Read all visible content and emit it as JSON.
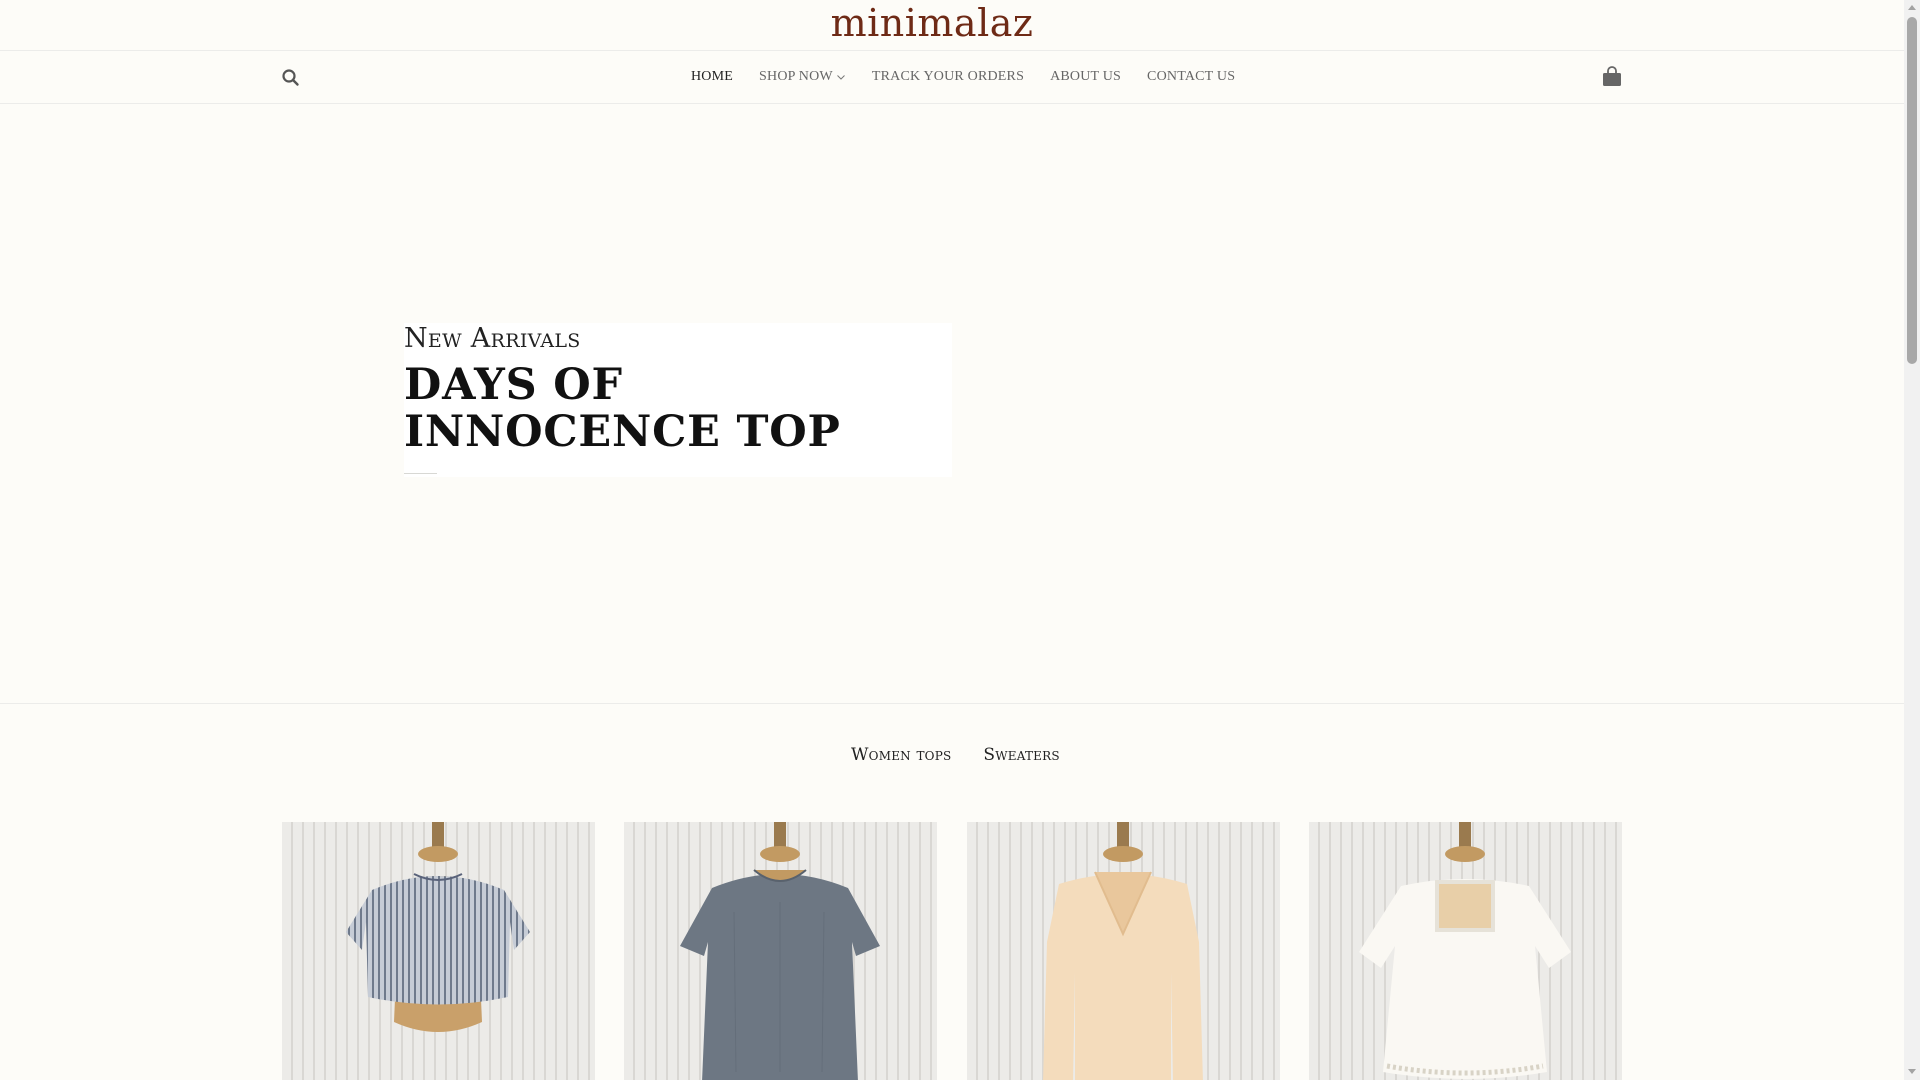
{
  "brand": {
    "logo_text": "minimalaz",
    "logo_color": "#6e2a16"
  },
  "nav": {
    "items": [
      {
        "label": "HOME",
        "active": true
      },
      {
        "label": "SHOP NOW",
        "has_dropdown": true
      },
      {
        "label": "TRACK YOUR ORDERS"
      },
      {
        "label": "ABOUT US"
      },
      {
        "label": "CONTACT US"
      }
    ],
    "search_icon": "search-icon",
    "cart_icon": "shopping-bag-icon"
  },
  "hero": {
    "kicker": "New Arrivals",
    "title": "DAYS OF INNOCENCE TOP"
  },
  "categories": {
    "tabs": [
      {
        "label": "Women tops"
      },
      {
        "label": "Sweaters"
      }
    ]
  },
  "products": [
    {
      "image": "striped-linen-crop-top"
    },
    {
      "image": "grey-gauze-tee"
    },
    {
      "image": "cream-vneck-knit"
    },
    {
      "image": "white-lace-peasant-blouse"
    }
  ],
  "colors": {
    "background": "#fdfcf8",
    "accent": "#6e2a16",
    "nav_text": "#666666",
    "nav_active": "#222222"
  }
}
